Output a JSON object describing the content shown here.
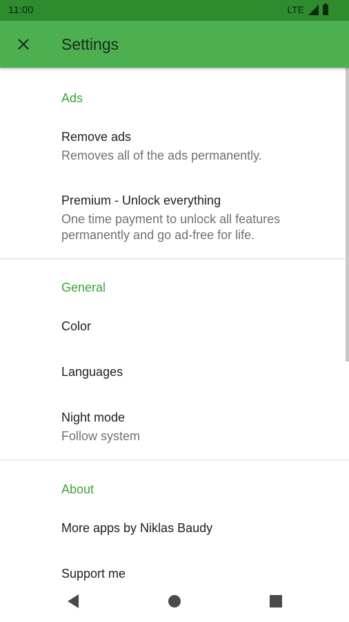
{
  "status_bar": {
    "time": "11:00",
    "network": "LTE",
    "icons": [
      "signal-icon",
      "battery-icon"
    ]
  },
  "app_bar": {
    "title": "Settings",
    "close_icon": "close-icon"
  },
  "sections": {
    "ads": {
      "header": "Ads",
      "remove_ads": {
        "title": "Remove ads",
        "summary": "Removes all of the ads permanently."
      },
      "premium": {
        "title": "Premium - Unlock everything",
        "summary": "One time payment to unlock all features permanently and go ad-free for life."
      }
    },
    "general": {
      "header": "General",
      "color": {
        "title": "Color"
      },
      "languages": {
        "title": "Languages"
      },
      "night_mode": {
        "title": "Night mode",
        "summary": "Follow system"
      }
    },
    "about": {
      "header": "About",
      "more_apps": {
        "title": "More apps by Niklas Baudy"
      },
      "support": {
        "title": "Support me"
      }
    }
  },
  "nav_bar": {
    "icons": [
      "back-icon",
      "home-icon",
      "recents-icon"
    ]
  },
  "colors": {
    "status_bar": "#2e8b2e",
    "app_bar": "#4caf50",
    "accent": "#3aa33a"
  }
}
